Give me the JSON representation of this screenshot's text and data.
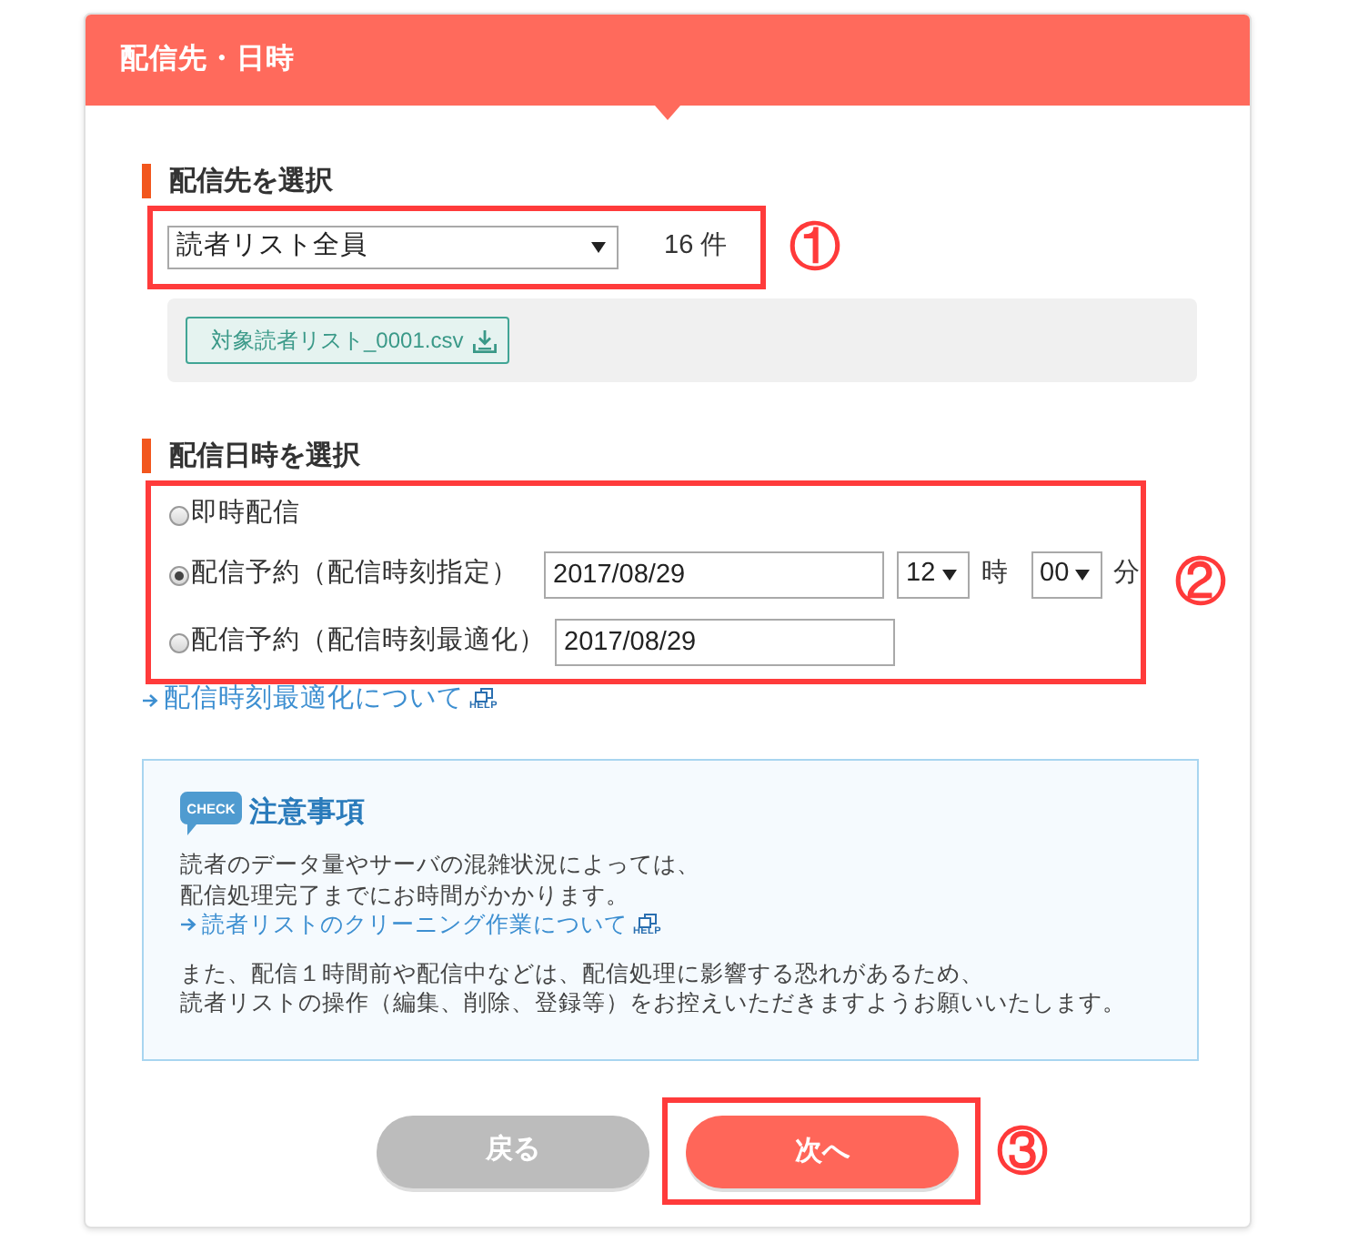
{
  "panel": {
    "title": "配信先・日時"
  },
  "destination": {
    "heading": "配信先を選択",
    "highlighted": true,
    "list_select": {
      "value": "読者リスト全員"
    },
    "count": "16 件",
    "callout": "①",
    "csv_button": {
      "label": "対象読者リスト_0001.csv"
    }
  },
  "schedule": {
    "heading": "配信日時を選択",
    "highlighted": true,
    "callout": "②",
    "options": [
      {
        "kind": "plain",
        "label": "即時配信",
        "selected": false
      },
      {
        "kind": "datetime",
        "label": "配信予約（配信時刻指定）",
        "selected": true,
        "date": "2017/08/29",
        "hour": "12",
        "hour_unit": "時",
        "minute": "00",
        "minute_unit": "分"
      },
      {
        "kind": "date",
        "label": "配信予約（配信時刻最適化）",
        "selected": false,
        "date": "2017/08/29"
      }
    ],
    "help_link": {
      "label": "配信時刻最適化について",
      "badge": "HELP"
    }
  },
  "notice": {
    "badge": "CHECK",
    "title": "注意事項",
    "blocks": [
      {
        "kind": "text",
        "lines": [
          "読者のデータ量やサーバの混雑状況によっては、",
          "配信処理完了までにお時間がかかります。"
        ]
      },
      {
        "kind": "link",
        "label": "読者リストのクリーニング作業について",
        "badge": "HELP"
      },
      {
        "kind": "text",
        "lines": [
          "また、配信１時間前や配信中などは、配信処理に影響する恐れがあるため、",
          "読者リストの操作（編集、削除、登録等）をお控えいただきますようお願いいたします。"
        ]
      }
    ]
  },
  "buttons": [
    {
      "kind": "back",
      "label": "戻る",
      "highlighted": false
    },
    {
      "kind": "next",
      "label": "次へ",
      "highlighted": true,
      "callout": "③"
    }
  ]
}
